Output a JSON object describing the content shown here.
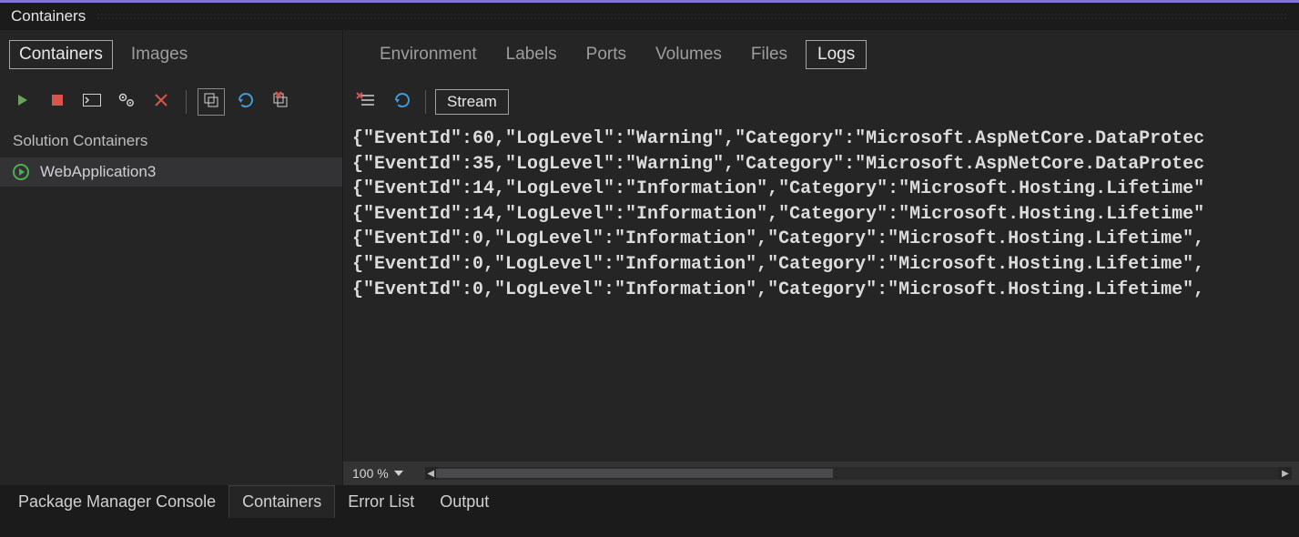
{
  "panel": {
    "title": "Containers"
  },
  "left_tabs": [
    "Containers",
    "Images"
  ],
  "left_active_tab": 0,
  "section_header": "Solution Containers",
  "containers": [
    {
      "name": "WebApplication3",
      "status": "running"
    }
  ],
  "detail_tabs": [
    "Environment",
    "Labels",
    "Ports",
    "Volumes",
    "Files",
    "Logs"
  ],
  "detail_active_tab": 5,
  "log_toolbar": {
    "stream_label": "Stream"
  },
  "zoom": {
    "level": "100 %"
  },
  "logs": [
    "{\"EventId\":60,\"LogLevel\":\"Warning\",\"Category\":\"Microsoft.AspNetCore.DataProtec",
    "{\"EventId\":35,\"LogLevel\":\"Warning\",\"Category\":\"Microsoft.AspNetCore.DataProtec",
    "{\"EventId\":14,\"LogLevel\":\"Information\",\"Category\":\"Microsoft.Hosting.Lifetime\"",
    "{\"EventId\":14,\"LogLevel\":\"Information\",\"Category\":\"Microsoft.Hosting.Lifetime\"",
    "{\"EventId\":0,\"LogLevel\":\"Information\",\"Category\":\"Microsoft.Hosting.Lifetime\",",
    "{\"EventId\":0,\"LogLevel\":\"Information\",\"Category\":\"Microsoft.Hosting.Lifetime\",",
    "{\"EventId\":0,\"LogLevel\":\"Information\",\"Category\":\"Microsoft.Hosting.Lifetime\","
  ],
  "bottom_tabs": [
    "Package Manager Console",
    "Containers",
    "Error List",
    "Output"
  ],
  "bottom_active_tab": 1
}
